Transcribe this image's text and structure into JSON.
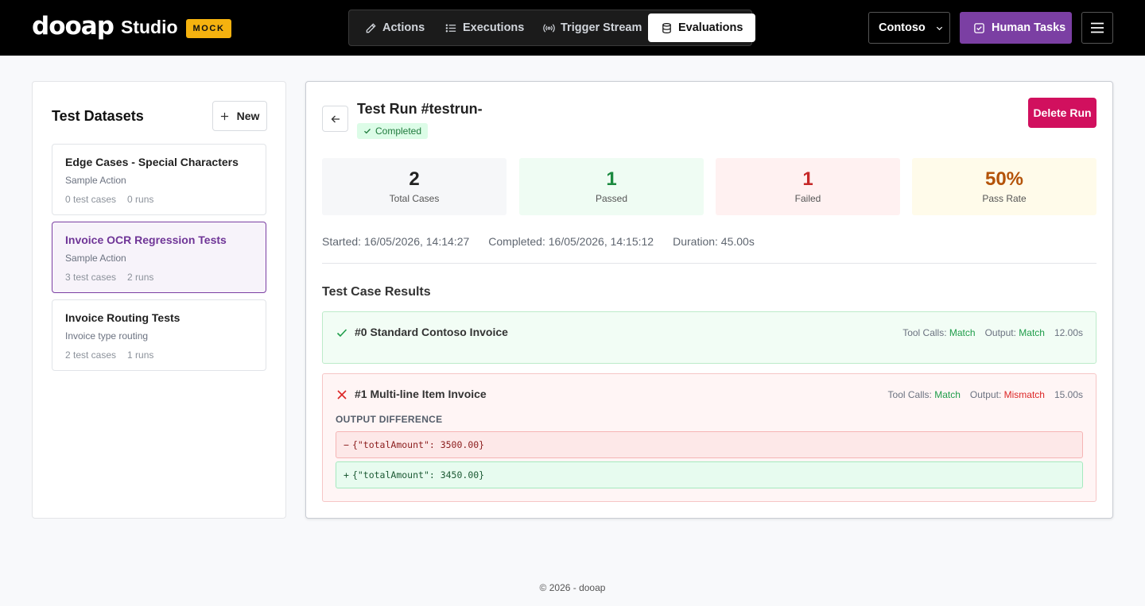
{
  "header": {
    "logo": "dooap",
    "studio": "Studio",
    "mock_badge": "MOCK",
    "tabs": [
      {
        "label": "Actions",
        "icon": "pencil-icon"
      },
      {
        "label": "Executions",
        "icon": "list-icon"
      },
      {
        "label": "Trigger Stream",
        "icon": "broadcast-icon"
      },
      {
        "label": "Evaluations",
        "icon": "database-icon",
        "active": true
      }
    ],
    "org_label": "Contoso",
    "human_tasks_label": "Human Tasks"
  },
  "sidebar": {
    "title": "Test Datasets",
    "new_label": "New",
    "datasets": [
      {
        "name": "Edge Cases - Special Characters",
        "subtitle": "Sample Action",
        "test_cases": "0 test cases",
        "runs": "0 runs"
      },
      {
        "name": "Invoice OCR Regression Tests",
        "subtitle": "Sample Action",
        "test_cases": "3 test cases",
        "runs": "2 runs",
        "selected": true
      },
      {
        "name": "Invoice Routing Tests",
        "subtitle": "Invoice type routing",
        "test_cases": "2 test cases",
        "runs": "1 runs"
      }
    ]
  },
  "run": {
    "title": "Test Run #testrun-",
    "status": "Completed",
    "delete_label": "Delete Run",
    "stats": [
      {
        "value": "2",
        "label": "Total Cases"
      },
      {
        "value": "1",
        "label": "Passed"
      },
      {
        "value": "1",
        "label": "Failed"
      },
      {
        "value": "50%",
        "label": "Pass Rate"
      }
    ],
    "started": "Started: 16/05/2026, 14:14:27",
    "completed": "Completed: 16/05/2026, 14:15:12",
    "duration": "Duration: 45.00s",
    "results_title": "Test Case Results",
    "cases": [
      {
        "name": "#0 Standard Contoso Invoice",
        "tool_calls_label": "Tool Calls:",
        "tool_calls": "Match",
        "output_label": "Output:",
        "output": "Match",
        "time": "12.00s"
      },
      {
        "name": "#1 Multi-line Item Invoice",
        "tool_calls_label": "Tool Calls:",
        "tool_calls": "Match",
        "output_label": "Output:",
        "output": "Mismatch",
        "time": "15.00s",
        "diff_label": "OUTPUT DIFFERENCE",
        "minus_sign": "−",
        "minus": "{\"totalAmount\": 3500.00}",
        "plus_sign": "+",
        "plus": "{\"totalAmount\": 3450.00}"
      }
    ]
  },
  "colors": {
    "accent": "#7b3fa3",
    "delete": "#d1105e",
    "mock": "#f5b20f",
    "pass": "#1f9d4a",
    "fail": "#dc2626",
    "pass_rate": "#b45309"
  },
  "footer": "© 2026 - dooap"
}
